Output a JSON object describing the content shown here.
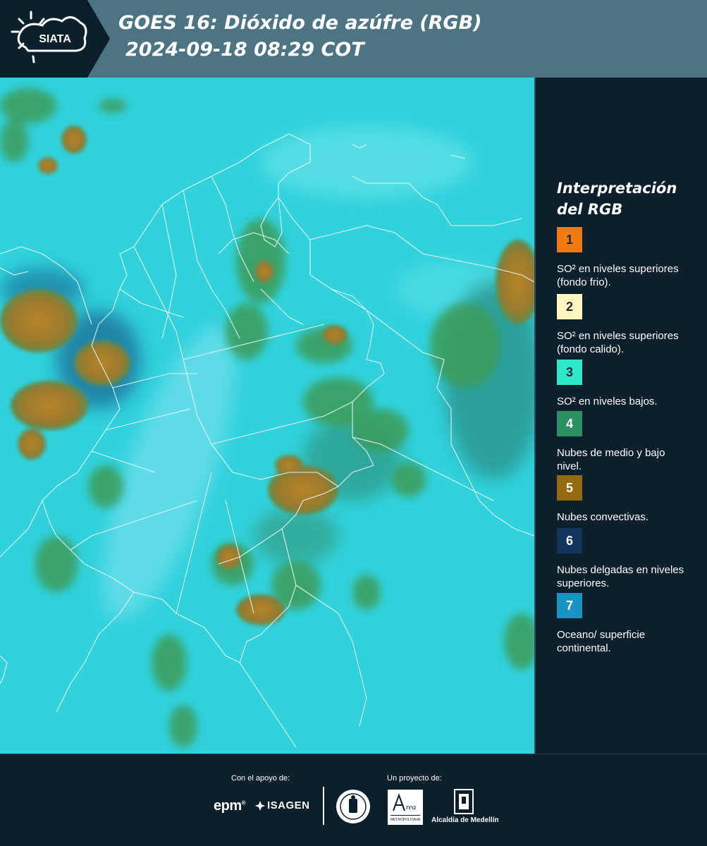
{
  "header": {
    "brand": "SIATA",
    "title_line1": "GOES 16: Dióxido de azúfre (RGB)",
    "title_line2": "2024-09-18 08:29 COT",
    "background_color": "#4d7482"
  },
  "map": {
    "background_color": "#31d2dc"
  },
  "legend": {
    "title": "Interpretación del RGB",
    "items": [
      {
        "number": "1",
        "color": "#f27a14",
        "text": "SO² en niveles superiores (fondo frio)."
      },
      {
        "number": "2",
        "color": "#fdf6c3",
        "text": "SO² en niveles superiores (fondo calido)."
      },
      {
        "number": "3",
        "color": "#2fe8c9",
        "text": "SO² en niveles bajos."
      },
      {
        "number": "4",
        "color": "#2b9163",
        "text": "Nubes de medio y bajo nivel."
      },
      {
        "number": "5",
        "color": "#946910",
        "text": "Nubes convectivas."
      },
      {
        "number": "6",
        "color": "#12355f",
        "text": "Nubes delgadas en niveles superiores."
      },
      {
        "number": "7",
        "color": "#1b93c2",
        "text": "Oceano/ superficie continental."
      }
    ]
  },
  "footer": {
    "support_label": "Con el apoyo de:",
    "project_label": "Un proyecto de:",
    "sponsor_epm": "epm",
    "sponsor_isagen": "ISAGEN",
    "alcaldia_label": "Alcaldía de Medellín",
    "area_logo_text": "Área Metropolitana Valle de Aburrá"
  }
}
